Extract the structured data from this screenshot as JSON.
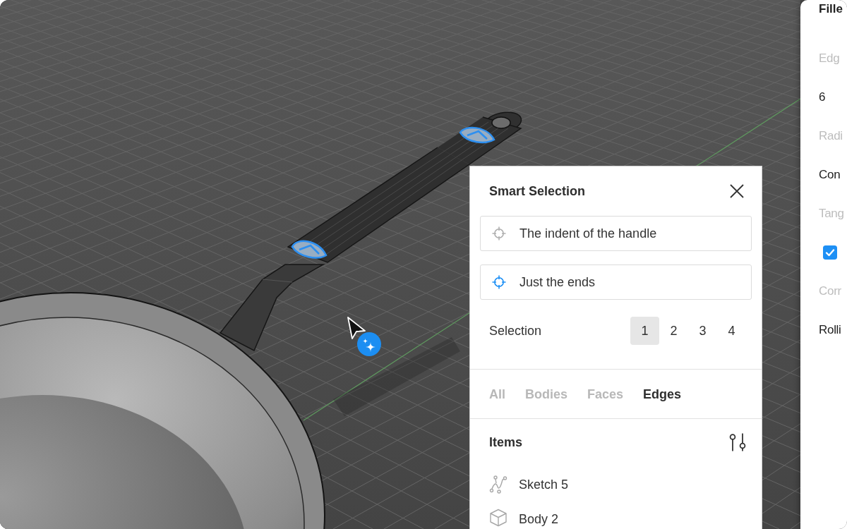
{
  "smart_selection": {
    "title": "Smart Selection",
    "prompts": [
      {
        "text": "The indent of the handle",
        "selected": false
      },
      {
        "text": "Just the ends",
        "selected": true
      }
    ],
    "selection": {
      "label": "Selection",
      "options": [
        {
          "label": "1",
          "selected": true
        },
        {
          "label": "2",
          "selected": false
        },
        {
          "label": "3",
          "selected": false
        },
        {
          "label": "4",
          "selected": false
        }
      ]
    },
    "tabs": [
      {
        "label": "All",
        "selected": false
      },
      {
        "label": "Bodies",
        "selected": false
      },
      {
        "label": "Faces",
        "selected": false
      },
      {
        "label": "Edges",
        "selected": true
      }
    ],
    "items": {
      "title": "Items",
      "list": [
        {
          "label": "Sketch 5",
          "kind": "sketch"
        },
        {
          "label": "Body 2",
          "kind": "body"
        }
      ]
    }
  },
  "properties_panel": {
    "title": "Fille",
    "rows": [
      {
        "label": "Edg",
        "kind": "text",
        "value": "6"
      },
      {
        "label": "Radi",
        "kind": "text",
        "value": "Con"
      },
      {
        "label": "Tang",
        "kind": "checkbox",
        "checked": true
      },
      {
        "label": "Corr",
        "kind": "text",
        "value": "Rolli"
      }
    ]
  }
}
